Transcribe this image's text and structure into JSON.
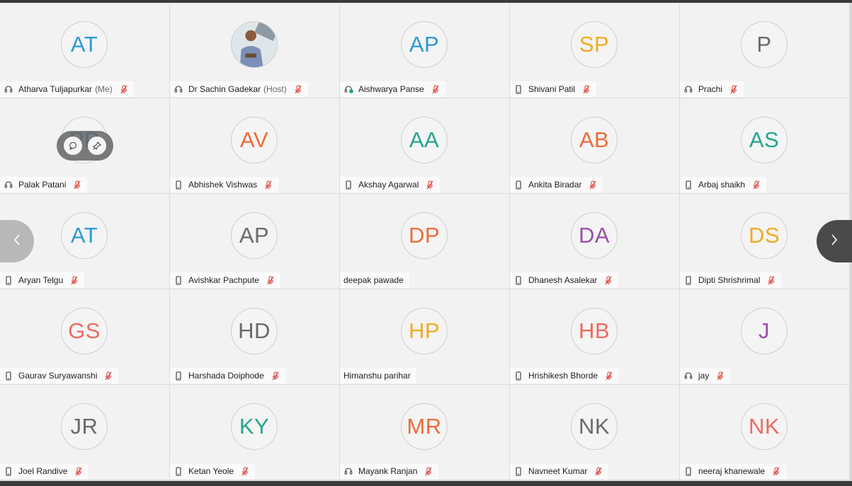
{
  "colors": {
    "blue": "#2b9ad6",
    "gray": "#6a6a6a",
    "amber": "#f0ab22",
    "teal": "#24a58e",
    "orange": "#ef6a37",
    "purple": "#9b4ea8",
    "coral": "#ee6a5f",
    "mic_off": "#d9342b"
  },
  "participants": [
    {
      "initials": "AT",
      "color": "#2b9ad6",
      "name": "Atharva Tuljapurkar",
      "suffix": "(Me)",
      "device": "headset-icon",
      "muted": true
    },
    {
      "initials": "",
      "photo": true,
      "color": "#6a6a6a",
      "name": "Dr Sachin Gadekar",
      "suffix": "(Host)",
      "device": "headset-icon",
      "muted": true
    },
    {
      "initials": "AP",
      "color": "#2b9ad6",
      "name": "Aishwarya Panse",
      "suffix": "",
      "device": "headset-active-icon",
      "muted": true
    },
    {
      "initials": "SP",
      "color": "#f0ab22",
      "name": "Shivani Patil",
      "suffix": "",
      "device": "phone-icon",
      "muted": true
    },
    {
      "initials": "P",
      "color": "#6a6a6a",
      "name": "Prachi",
      "suffix": "",
      "device": "headset-icon",
      "muted": true
    },
    {
      "initials": "PP",
      "color": "#2b9ad6",
      "name": "Palak Patani",
      "suffix": "",
      "device": "headset-icon",
      "muted": true
    },
    {
      "initials": "AV",
      "color": "#ef6a37",
      "name": "Abhishek Vishwas",
      "suffix": "",
      "device": "phone-icon",
      "muted": true
    },
    {
      "initials": "AA",
      "color": "#24a58e",
      "name": "Akshay Agarwal",
      "suffix": "",
      "device": "phone-icon",
      "muted": true
    },
    {
      "initials": "AB",
      "color": "#ef6a37",
      "name": "Ankita Biradar",
      "suffix": "",
      "device": "phone-icon",
      "muted": true
    },
    {
      "initials": "AS",
      "color": "#24a58e",
      "name": "Arbaj shaikh",
      "suffix": "",
      "device": "phone-icon",
      "muted": true
    },
    {
      "initials": "AT",
      "color": "#2b9ad6",
      "name": "Aryan Telgu",
      "suffix": "",
      "device": "phone-icon",
      "muted": true
    },
    {
      "initials": "AP",
      "color": "#6a6a6a",
      "name": "Avishkar Pachpute",
      "suffix": "",
      "device": "phone-icon",
      "muted": true
    },
    {
      "initials": "DP",
      "color": "#ef6a37",
      "name": "deepak pawade",
      "suffix": "",
      "device": "",
      "muted": false
    },
    {
      "initials": "DA",
      "color": "#9b4ea8",
      "name": "Dhanesh Asalekar",
      "suffix": "",
      "device": "phone-icon",
      "muted": true
    },
    {
      "initials": "DS",
      "color": "#f0ab22",
      "name": "Dipti Shrishrimal",
      "suffix": "",
      "device": "phone-icon",
      "muted": true
    },
    {
      "initials": "GS",
      "color": "#ee6a5f",
      "name": "Gaurav Suryawanshi",
      "suffix": "",
      "device": "phone-icon",
      "muted": true
    },
    {
      "initials": "HD",
      "color": "#6a6a6a",
      "name": "Harshada Doiphode",
      "suffix": "",
      "device": "phone-icon",
      "muted": true
    },
    {
      "initials": "HP",
      "color": "#f0ab22",
      "name": "Himanshu parihar",
      "suffix": "",
      "device": "",
      "muted": false
    },
    {
      "initials": "HB",
      "color": "#ee6a5f",
      "name": "Hrishikesh Bhorde",
      "suffix": "",
      "device": "phone-icon",
      "muted": true
    },
    {
      "initials": "J",
      "color": "#9b4ea8",
      "name": "jay",
      "suffix": "",
      "device": "headset-icon",
      "muted": true
    },
    {
      "initials": "JR",
      "color": "#6a6a6a",
      "name": "Joel Randive",
      "suffix": "",
      "device": "phone-icon",
      "muted": true
    },
    {
      "initials": "KY",
      "color": "#24a58e",
      "name": "Ketan Yeole",
      "suffix": "",
      "device": "phone-icon",
      "muted": true
    },
    {
      "initials": "MR",
      "color": "#ef6a37",
      "name": "Mayank Ranjan",
      "suffix": "",
      "device": "headset-icon",
      "muted": true
    },
    {
      "initials": "NK",
      "color": "#6a6a6a",
      "name": "Navneet Kumar",
      "suffix": "",
      "device": "phone-icon",
      "muted": true
    },
    {
      "initials": "NK",
      "color": "#ee6a5f",
      "name": "neeraj khanewale",
      "suffix": "",
      "device": "phone-icon",
      "muted": true
    }
  ],
  "hover_overlay": {
    "tile_index": 5,
    "buttons": [
      "chat-icon",
      "pin-icon"
    ]
  },
  "navigation": {
    "prev_icon": "chevron-left-icon",
    "next_icon": "chevron-right-icon"
  }
}
